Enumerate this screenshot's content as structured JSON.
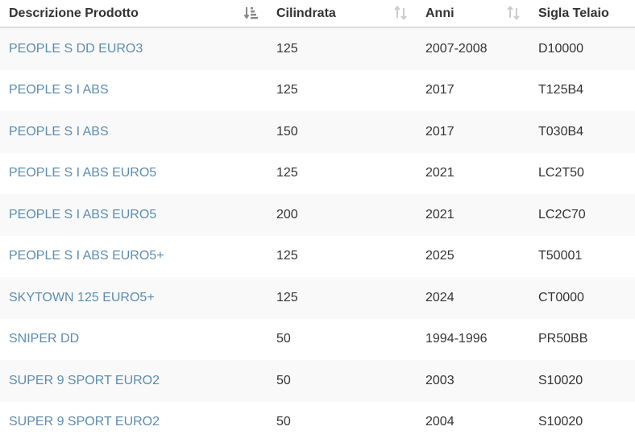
{
  "table": {
    "headers": [
      {
        "label": "Descrizione Prodotto",
        "sort_icon": "sort-alpha-desc-icon",
        "sort_active": true
      },
      {
        "label": "Cilindrata",
        "sort_icon": "sort-both-icon",
        "sort_active": false
      },
      {
        "label": "Anni",
        "sort_icon": "sort-both-icon",
        "sort_active": false
      },
      {
        "label": "Sigla Telaio"
      }
    ],
    "rows": [
      {
        "desc": "PEOPLE S DD EURO3",
        "cc": "125",
        "years": "2007-2008",
        "frame": "D10000"
      },
      {
        "desc": "PEOPLE S I ABS",
        "cc": "125",
        "years": "2017",
        "frame": "T125B4"
      },
      {
        "desc": "PEOPLE S I ABS",
        "cc": "150",
        "years": "2017",
        "frame": "T030B4"
      },
      {
        "desc": "PEOPLE S I ABS EURO5",
        "cc": "125",
        "years": "2021",
        "frame": "LC2T50"
      },
      {
        "desc": "PEOPLE S I ABS EURO5",
        "cc": "200",
        "years": "2021",
        "frame": "LC2C70"
      },
      {
        "desc": "PEOPLE S I ABS EURO5+",
        "cc": "125",
        "years": "2025",
        "frame": "T50001"
      },
      {
        "desc": "SKYTOWN 125 EURO5+",
        "cc": "125",
        "years": "2024",
        "frame": "CT0000"
      },
      {
        "desc": "SNIPER DD",
        "cc": "50",
        "years": "1994-1996",
        "frame": "PR50BB"
      },
      {
        "desc": "SUPER 9 SPORT EURO2",
        "cc": "50",
        "years": "2003",
        "frame": "S10020"
      },
      {
        "desc": "SUPER 9 SPORT EURO2",
        "cc": "50",
        "years": "2004",
        "frame": "S10020"
      }
    ]
  },
  "colors": {
    "link": "#5b8db2",
    "text": "#333333",
    "stripe": "#f9f9f9",
    "border": "#dddddd",
    "sort_active": "#888888",
    "sort_inactive": "#cccccc"
  }
}
